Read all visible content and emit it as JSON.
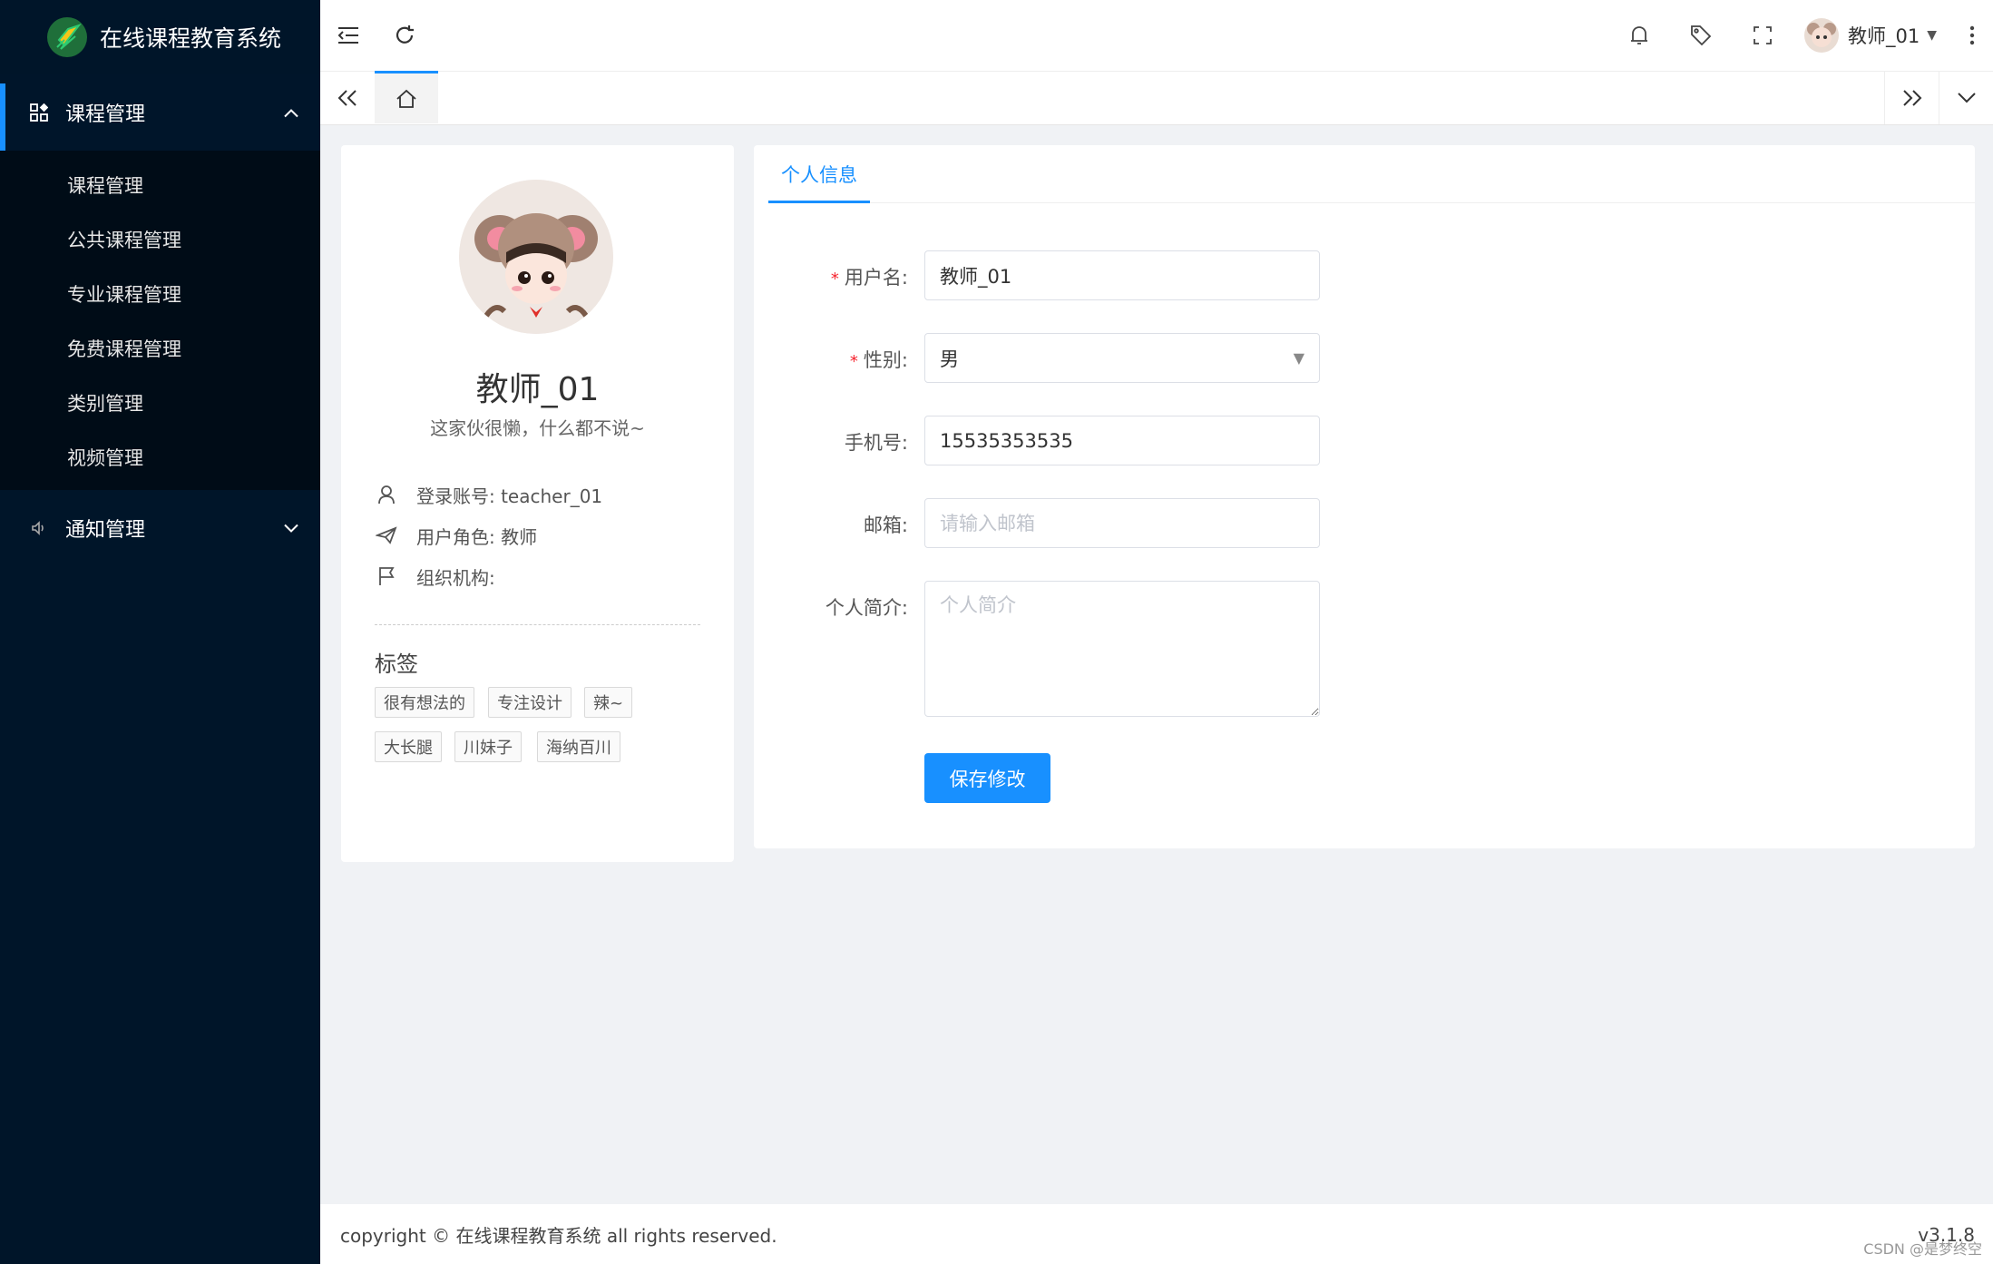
{
  "app": {
    "title": "在线课程教育系统"
  },
  "sidebar": {
    "groups": [
      {
        "label": "课程管理",
        "icon": "grid-icon",
        "expanded": true,
        "items": [
          {
            "label": "课程管理"
          },
          {
            "label": "公共课程管理"
          },
          {
            "label": "专业课程管理"
          },
          {
            "label": "免费课程管理"
          },
          {
            "label": "类别管理"
          },
          {
            "label": "视频管理"
          }
        ]
      },
      {
        "label": "通知管理",
        "icon": "speaker-icon",
        "expanded": false
      }
    ]
  },
  "header": {
    "user_name": "教师_01"
  },
  "profile": {
    "name": "教师_01",
    "signature": "这家伙很懒，什么都不说~",
    "account": "登录账号: teacher_01",
    "role": "用户角色: 教师",
    "org": "组织机构:",
    "tags_title": "标签",
    "tags": [
      "很有想法的",
      "专注设计",
      "辣~",
      "大长腿",
      "川妹子",
      "海纳百川"
    ]
  },
  "form": {
    "tab": "个人信息",
    "username_label": "用户名:",
    "username_value": "教师_01",
    "gender_label": "性别:",
    "gender_value": "男",
    "phone_label": "手机号:",
    "phone_value": "15535353535",
    "email_label": "邮箱:",
    "email_placeholder": "请输入邮箱",
    "bio_label": "个人简介:",
    "bio_placeholder": "个人简介",
    "save_label": "保存修改"
  },
  "footer": {
    "copyright": "copyright © 在线课程教育系统 all rights reserved.",
    "version": "v3.1.8",
    "watermark": "CSDN @是梦终空"
  },
  "colors": {
    "sidebar_bg": "#001529",
    "accent": "#1890ff",
    "required": "#f5222d"
  }
}
